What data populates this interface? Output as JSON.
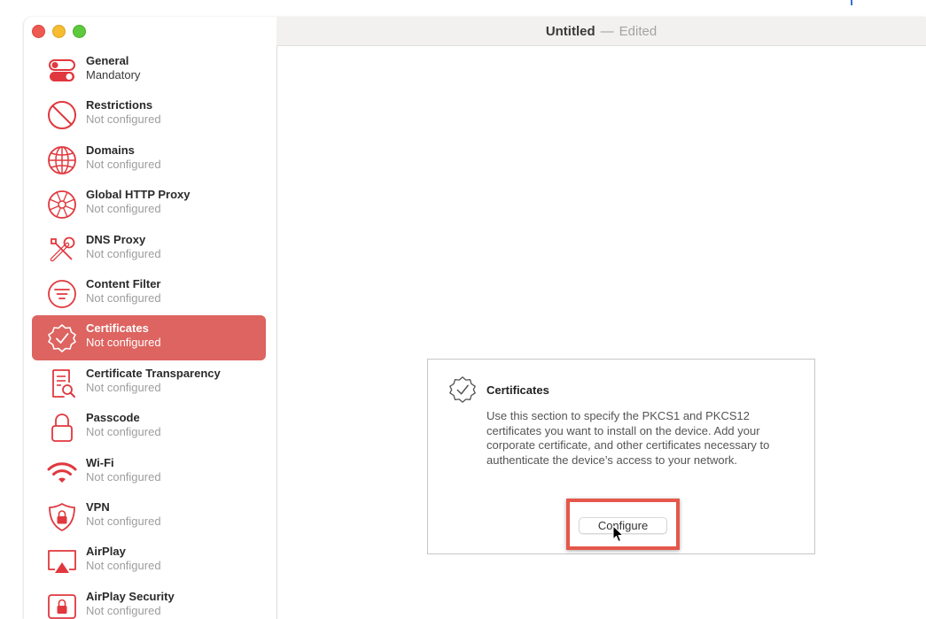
{
  "window": {
    "title": "Untitled",
    "separator": "—",
    "edited": "Edited"
  },
  "sidebar": {
    "items": [
      {
        "name": "General",
        "status": "Mandatory",
        "icon": "toggle-icon"
      },
      {
        "name": "Restrictions",
        "status": "Not configured",
        "icon": "no-entry-icon"
      },
      {
        "name": "Domains",
        "status": "Not configured",
        "icon": "globe-icon"
      },
      {
        "name": "Global HTTP Proxy",
        "status": "Not configured",
        "icon": "globe-network-icon"
      },
      {
        "name": "DNS Proxy",
        "status": "Not configured",
        "icon": "tools-icon"
      },
      {
        "name": "Content Filter",
        "status": "Not configured",
        "icon": "filter-icon"
      },
      {
        "name": "Certificates",
        "status": "Not configured",
        "icon": "certificate-badge-icon",
        "selected": true
      },
      {
        "name": "Certificate Transparency",
        "status": "Not configured",
        "icon": "document-search-icon"
      },
      {
        "name": "Passcode",
        "status": "Not configured",
        "icon": "lock-icon"
      },
      {
        "name": "Wi-Fi",
        "status": "Not configured",
        "icon": "wifi-icon"
      },
      {
        "name": "VPN",
        "status": "Not configured",
        "icon": "vpn-shield-icon"
      },
      {
        "name": "AirPlay",
        "status": "Not configured",
        "icon": "airplay-icon"
      },
      {
        "name": "AirPlay Security",
        "status": "Not configured",
        "icon": "airplay-lock-icon"
      }
    ]
  },
  "card": {
    "title": "Certificates",
    "description": "Use this section to specify the PKCS1 and PKCS12 certificates you want to install on the device. Add your corporate certificate, and other certificates necessary to authenticate the device’s access to your network.",
    "button_label": "Configure"
  },
  "colors": {
    "accent": "#dd6460",
    "icon_red": "#e0383e",
    "highlight": "#e5574b"
  }
}
